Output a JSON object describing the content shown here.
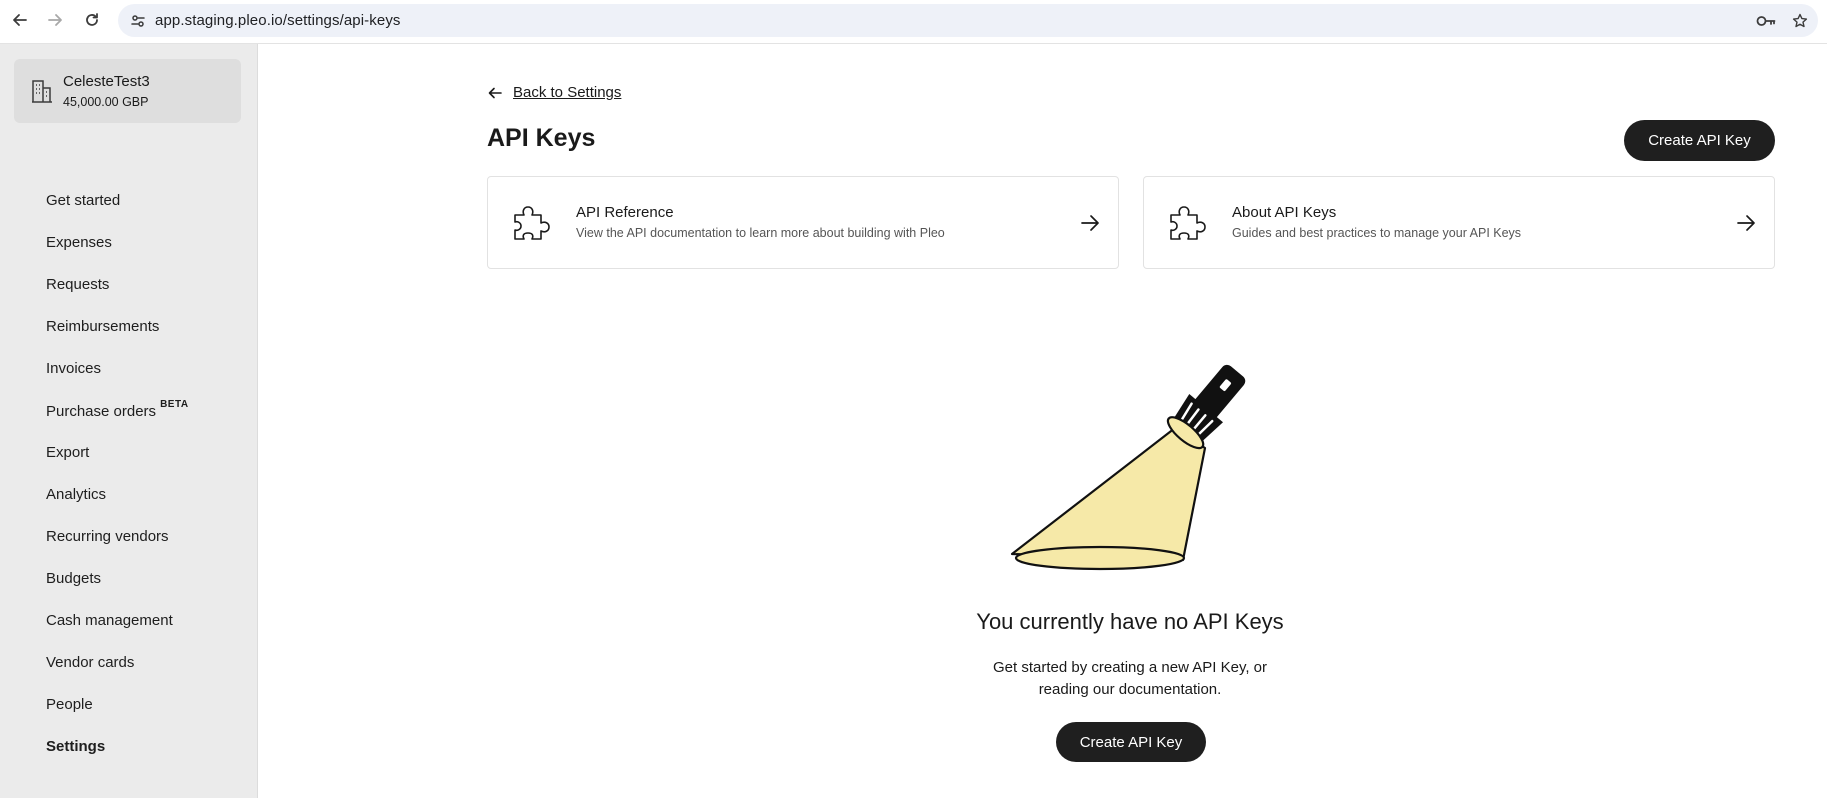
{
  "browser": {
    "url": "app.staging.pleo.io/settings/api-keys",
    "icons": [
      "back-icon",
      "forward-icon",
      "reload-icon",
      "site-info-icon",
      "password-key-icon",
      "bookmark-star-icon"
    ]
  },
  "sidebar": {
    "company": {
      "name": "CelesteTest3",
      "balance": "45,000.00 GBP",
      "icon": "building-icon"
    },
    "items": [
      {
        "label": "Get started"
      },
      {
        "label": "Expenses"
      },
      {
        "label": "Requests"
      },
      {
        "label": "Reimbursements"
      },
      {
        "label": "Invoices"
      },
      {
        "label": "Purchase orders",
        "badge": "BETA"
      },
      {
        "label": "Export"
      },
      {
        "label": "Analytics"
      },
      {
        "label": "Recurring vendors"
      },
      {
        "label": "Budgets"
      },
      {
        "label": "Cash management"
      },
      {
        "label": "Vendor cards"
      },
      {
        "label": "People"
      },
      {
        "label": "Settings",
        "active": true
      }
    ]
  },
  "main": {
    "back_label": "Back to Settings",
    "title": "API Keys",
    "create_button": "Create API Key",
    "cards": [
      {
        "title": "API Reference",
        "subtitle": "View the API documentation to learn more about building with Pleo",
        "icon": "puzzle-icon"
      },
      {
        "title": "About API Keys",
        "subtitle": "Guides and best practices to manage your API Keys",
        "icon": "puzzle-icon"
      }
    ],
    "empty_state": {
      "title": "You currently have no API Keys",
      "line1": "Get started by creating a new API Key, or",
      "line2": "reading our documentation.",
      "button": "Create API Key",
      "illustration": "flashlight-illustration"
    }
  },
  "colors": {
    "sidebar_bg": "#ebebeb",
    "button_bg": "#1f1f1f",
    "beam_fill": "#f6e9a8"
  }
}
